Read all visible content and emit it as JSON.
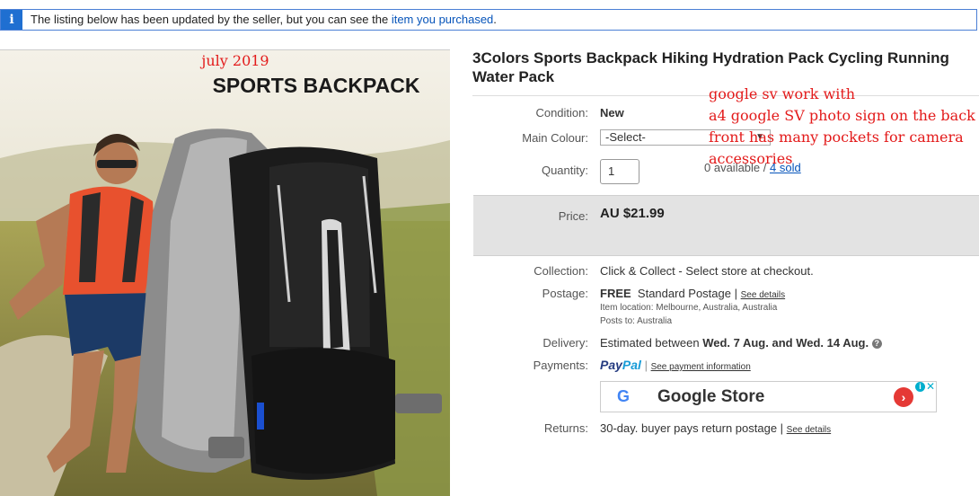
{
  "notice": {
    "icon": "info-icon",
    "message": "The listing below has been updated by the seller, but you can see the ",
    "link": "item you purchased",
    "end": "."
  },
  "photo": {
    "annotation": "july 2019",
    "banner": "SPORTS BACKPACK"
  },
  "listing": {
    "title": "3Colors Sports Backpack Hiking Hydration Pack Cycling Running Water Pack",
    "condition_label": "Condition:",
    "condition_value": "New",
    "colour_label": "Main Colour:",
    "colour_value": "-Select-",
    "quantity_label": "Quantity:",
    "quantity_value": "1",
    "availability": "0 available / ",
    "sold_link": "4 sold",
    "price_label": "Price:",
    "price_value": "AU $21.99",
    "collection_label": "Collection:",
    "collection_value": "Click & Collect - Select store at checkout.",
    "postage_label": "Postage:",
    "postage_free": "FREE",
    "postage_method": "Standard Postage",
    "postage_sep": "|",
    "postage_details": "See details",
    "item_location": "Item location:  Melbourne, Australia, Australia",
    "posts_to": "Posts to:  Australia",
    "delivery_label": "Delivery:",
    "delivery_prefix": "Estimated between ",
    "delivery_dates": "Wed. 7 Aug. and Wed. 14 Aug.",
    "payments_label": "Payments:",
    "paypal_pay": "Pay",
    "paypal_pal": "Pal",
    "payment_info": "See payment information",
    "returns_label": "Returns:",
    "returns_value": "30-day. buyer pays return postage |",
    "returns_details": "See details"
  },
  "ad": {
    "logo": "G",
    "name": "Google Store",
    "arrow": "›",
    "info": "i",
    "close": "✕"
  },
  "annotation_lines": [
    "google sv work with",
    "a4 google SV photo sign on the back",
    "front has many pockets for camera",
    "accessories"
  ],
  "colors": {
    "accent_link": "#0654ba",
    "annotation_red": "#e31a1a",
    "info_blue": "#1f6fd1"
  }
}
